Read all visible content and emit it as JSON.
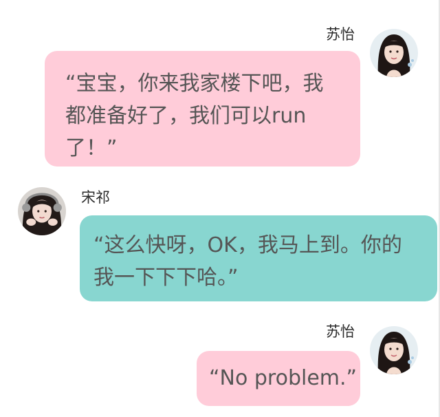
{
  "chat": {
    "messages": [
      {
        "sender": "苏怡",
        "side": "right",
        "bubble_color": "#ffccd9",
        "text": "“宝宝，你来我家楼下吧，我都准备好了，我们可以run了！”"
      },
      {
        "sender": "宋祁",
        "side": "left",
        "bubble_color": "#88d6d0",
        "text": "“这么快呀，OK，我马上到。你的我一下下下哈。”"
      },
      {
        "sender": "苏怡",
        "side": "right",
        "bubble_color": "#ffccd9",
        "text": "“No problem.”"
      }
    ]
  }
}
